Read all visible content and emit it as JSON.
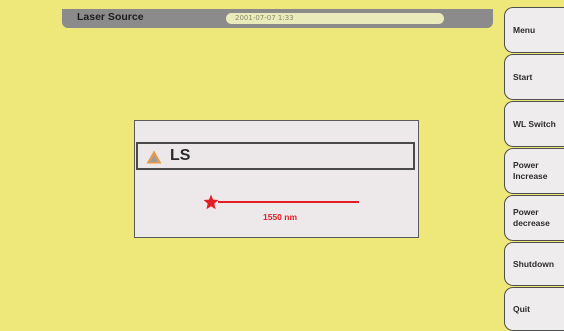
{
  "header": {
    "title": "Laser Source",
    "datetime": "2001-07-07   1:33"
  },
  "panel": {
    "mode_icon": "warning-triangle-icon",
    "mode_label": "LS",
    "wavelength": "1550 nm",
    "laser_icon": "laser-star-icon"
  },
  "sidebar": {
    "buttons": [
      {
        "label": "Menu"
      },
      {
        "label": "Start"
      },
      {
        "label": "WL Switch"
      },
      {
        "label": "Power\nIncrease"
      },
      {
        "label": "Power\ndecrease"
      },
      {
        "label": "Shutdown"
      },
      {
        "label": "Quit"
      }
    ]
  },
  "colors": {
    "background": "#eee77a",
    "header": "#8b8b8b",
    "laser": "#e21d24",
    "warning": "#e59a4b"
  }
}
